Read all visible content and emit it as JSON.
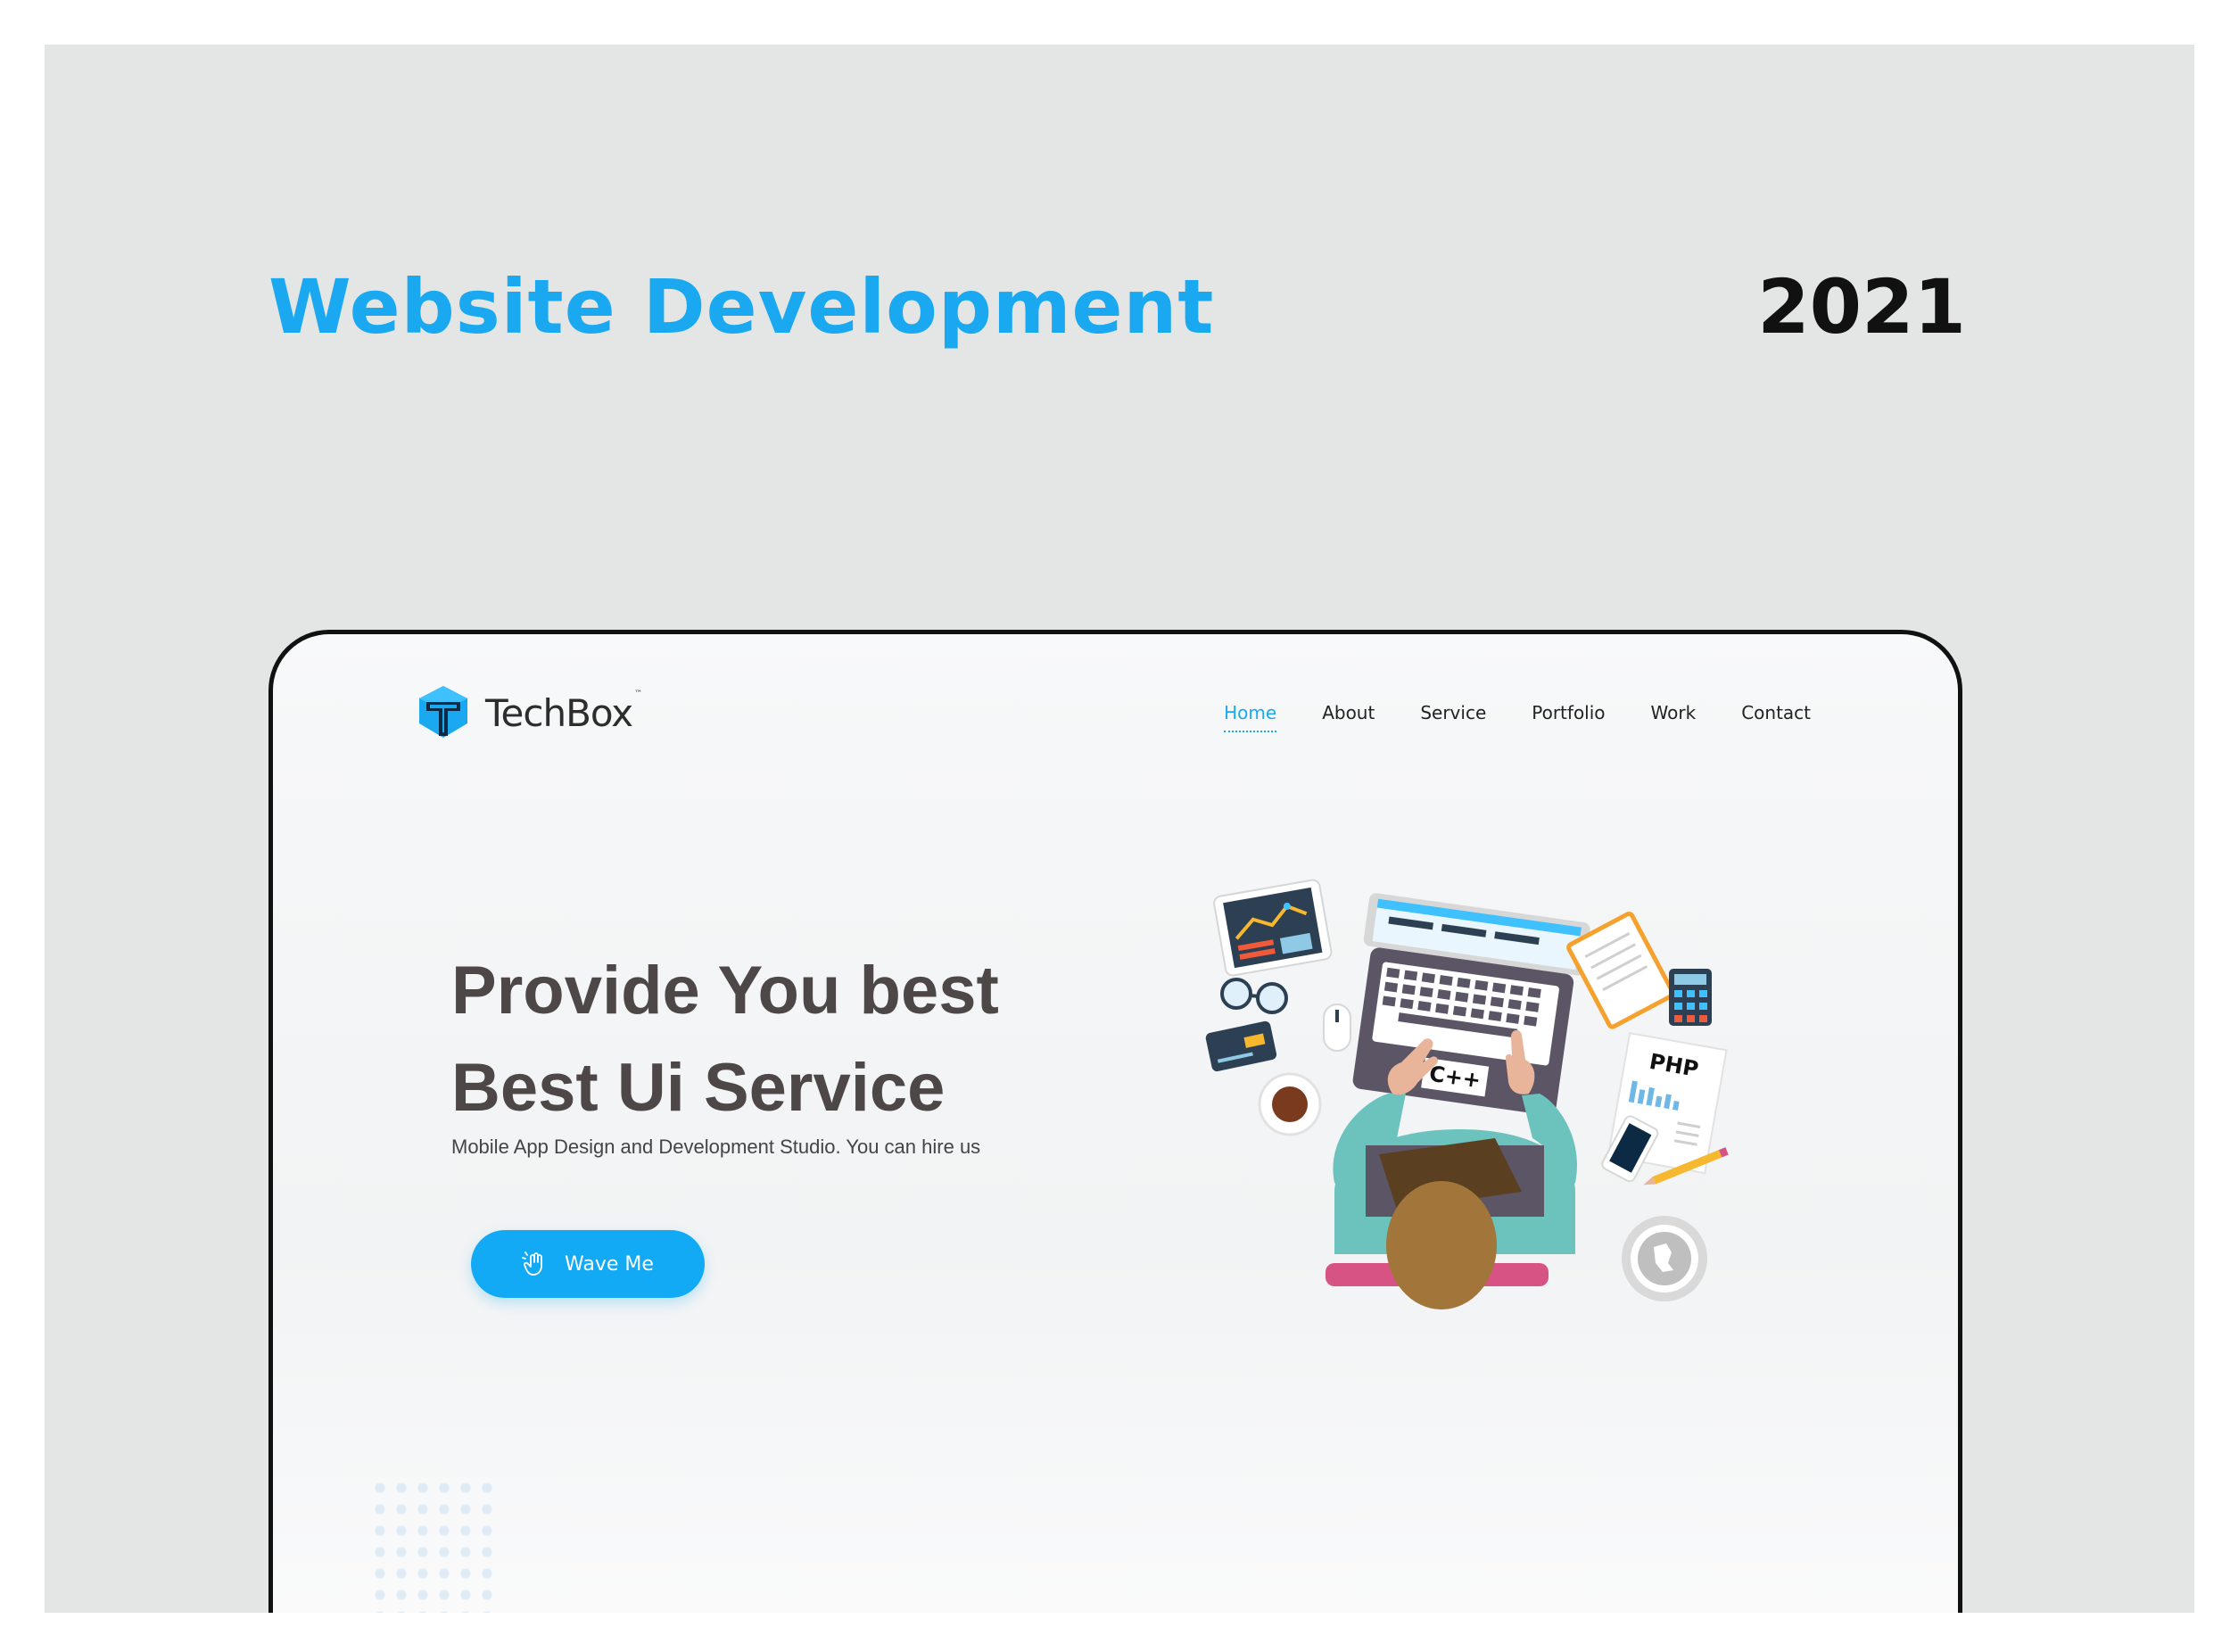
{
  "page": {
    "heading": "Website Development",
    "year": "2021"
  },
  "brand": {
    "name": "TechBox",
    "tm": "™"
  },
  "nav": {
    "items": [
      {
        "label": "Home",
        "active": true
      },
      {
        "label": "About",
        "active": false
      },
      {
        "label": "Service",
        "active": false
      },
      {
        "label": "Portfolio",
        "active": false
      },
      {
        "label": "Work",
        "active": false
      },
      {
        "label": "Contact",
        "active": false
      }
    ]
  },
  "hero": {
    "title_line1": "Provide You best",
    "title_line2": "Best Ui Service",
    "subtitle": "Mobile App Design and Development Studio. You can hire us",
    "cta_label": "Wave Me",
    "cta_icon": "waving-hand-icon"
  },
  "illustration": {
    "laptop_label": "C++",
    "doc_label": "PHP"
  },
  "colors": {
    "accent": "#1aa9f0",
    "button": "#12aaf5",
    "title": "#4d4847",
    "background": "#e4e6e5"
  }
}
